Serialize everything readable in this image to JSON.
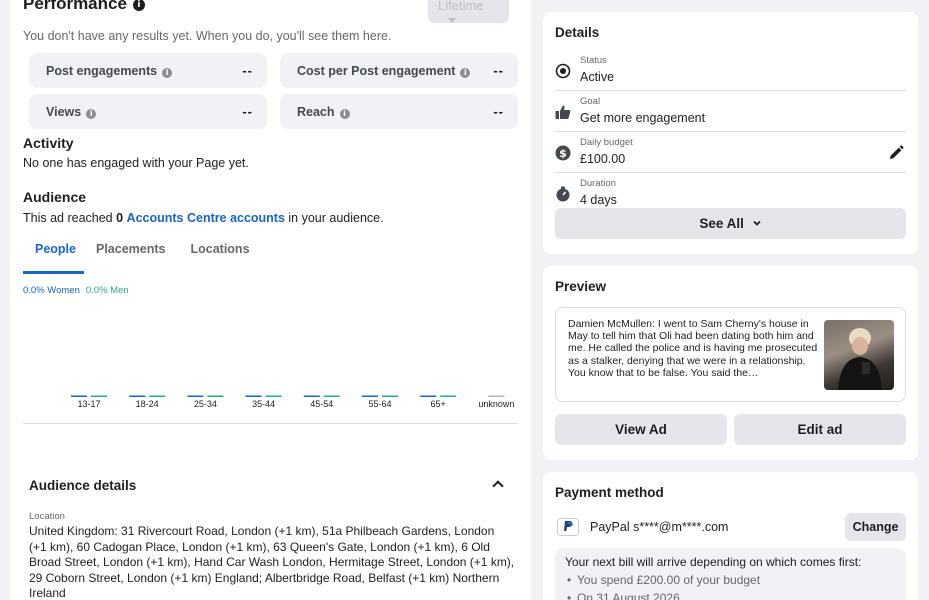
{
  "performance": {
    "title": "Performance",
    "info": "i",
    "filter": "Lifetime",
    "empty": "You don't have any results yet. When you do, you'll see them here.",
    "metrics": [
      {
        "label": "Post engagements",
        "value": "--"
      },
      {
        "label": "Cost per Post engagement",
        "value": "--"
      },
      {
        "label": "Views",
        "value": "--"
      },
      {
        "label": "Reach",
        "value": "--"
      }
    ]
  },
  "activity": {
    "title": "Activity",
    "text": "No one has engaged with your Page yet."
  },
  "audience": {
    "title": "Audience",
    "reach_prefix": "This ad reached ",
    "reach_count": "0",
    "reach_link": "Accounts Centre accounts",
    "reach_suffix": " in your audience.",
    "tabs": [
      "People",
      "Placements",
      "Locations"
    ],
    "legend_women": "0.0% Women",
    "legend_men": "0.0% Men"
  },
  "chart_data": {
    "type": "bar",
    "categories": [
      "13-17",
      "18-24",
      "25-34",
      "35-44",
      "45-54",
      "55-64",
      "65+",
      "unknown"
    ],
    "series": [
      {
        "name": "Women",
        "values": [
          0,
          0,
          0,
          0,
          0,
          0,
          0,
          0
        ]
      },
      {
        "name": "Men",
        "values": [
          0,
          0,
          0,
          0,
          0,
          0,
          0,
          0
        ]
      }
    ],
    "colors": {
      "women": "#1a64c8",
      "men": "#2aa88a",
      "unknown": "#b0b3b8"
    }
  },
  "audience_details": {
    "title": "Audience details",
    "location_label": "Location",
    "location_text": "United Kingdom: 31 Rivercourt Road, London (+1 km), 51a Philbeach Gardens, London (+1 km), 60 Cadogan Place, London (+1 km), 63 Queen's Gate, London (+1 km), 6 Old Broad Street, London (+1 km), Hand Car Wash London, Hermitage Street, London (+1 km), 29 Coborn Street, London (+1 km) England; Albertbridge Road, Belfast (+1 km) Northern Ireland"
  },
  "details": {
    "title": "Details",
    "rows": [
      {
        "label": "Status",
        "value": "Active",
        "icon": "radio-icon"
      },
      {
        "label": "Goal",
        "value": "Get more engagement",
        "icon": "thumbs-up-icon"
      },
      {
        "label": "Daily budget",
        "value": "£100.00",
        "icon": "dollar-icon"
      },
      {
        "label": "Duration",
        "value": "4 days",
        "icon": "stopwatch-icon"
      }
    ],
    "see_all": "See All"
  },
  "preview": {
    "title": "Preview",
    "text": "Damien McMullen: I went to Sam Cherny's house in May to tell him that Oli had been dating both him and me. He called the police and is having me prosecuted as a stalker, denying that we were in a relationship. You know that to be false. You said the…",
    "view_ad": "View Ad",
    "edit_ad": "Edit ad"
  },
  "payment": {
    "title": "Payment method",
    "method": "PayPal s****@m****.com",
    "change": "Change",
    "bill_title": "Your next bill will arrive depending on which comes first:",
    "bill_items": [
      "You spend £200.00 of your budget",
      "On 31 August 2026"
    ]
  }
}
